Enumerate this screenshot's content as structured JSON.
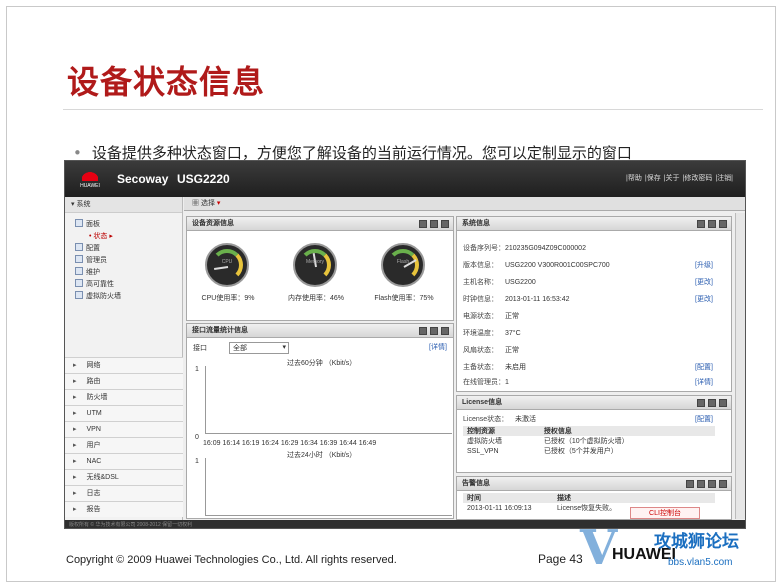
{
  "slide": {
    "title": "设备状态信息",
    "bullet": "设备提供多种状态窗口，方便您了解设备的当前运行情况。您可以定制显示的窗口",
    "copyright": "Copyright © 2009 Huawei Technologies Co., Ltd. All rights reserved.",
    "page": "Page 43",
    "footer_logo": "HUAWEI",
    "watermark_main": "攻城狮论坛",
    "watermark_sub": "bbs.vlan5.com",
    "watermark_letter": "V"
  },
  "app": {
    "logo_text": "HUAWEI",
    "brand": "Secoway",
    "model": "USG2220",
    "top_links": [
      "|帮助",
      "|保存",
      "|关于",
      "|修改密码",
      "|注销|"
    ],
    "toolbar_label": "选择",
    "sidebar_head": "系统",
    "tree": [
      "面板",
      "状态",
      "配置",
      "管理员",
      "维护",
      "高可靠性",
      "虚拟防火墙"
    ],
    "nav": [
      "网络",
      "路由",
      "防火墙",
      "UTM",
      "VPN",
      "用户",
      "NAC",
      "无线&DSL",
      "日志",
      "报告"
    ],
    "status_text": "版权所有 © 华为技术有限公司 2008-2012 保留一切权利",
    "cli_button": "CLI控制台"
  },
  "resource_panel": {
    "title": "设备资源信息",
    "gauges": [
      {
        "name": "CPU",
        "value": "9",
        "caption": "CPU使用率：9%",
        "percent": 9
      },
      {
        "name": "Memory",
        "value": "46",
        "caption": "内存使用率：46%",
        "percent": 46
      },
      {
        "name": "Flash",
        "value": "75",
        "caption": "Flash使用率：75%",
        "percent": 75
      }
    ]
  },
  "traffic_panel": {
    "title": "接口流量统计信息",
    "iface_label": "接口",
    "iface_value": "全部",
    "detail_link": "[详情]",
    "chart1_title": "过去60分钟 （Kbit/s）",
    "chart2_title": "过去24小时 （Kbit/s）",
    "y_top": "1",
    "y_bottom": "0",
    "y2_top": "1",
    "x_ticks": "16:09 16:14 16:19 16:24 16:29 16:34 16:39 16:44 16:49"
  },
  "system_panel": {
    "title": "系统信息",
    "rows": [
      {
        "label": "设备序列号：",
        "value": "210235G094Z09C000002",
        "link": ""
      },
      {
        "label": "版本信息：",
        "value": "USG2200 V300R001C00SPC700",
        "link": "[升级]"
      },
      {
        "label": "主机名称：",
        "value": "USG2200",
        "link": "[更改]"
      },
      {
        "label": "时钟信息：",
        "value": "2013-01-11 16:53:42",
        "link": "[更改]"
      },
      {
        "label": "电源状态：",
        "value": "正常",
        "link": ""
      },
      {
        "label": "环境温度：",
        "value": "37°C",
        "link": ""
      },
      {
        "label": "风扇状态：",
        "value": "正常",
        "link": ""
      },
      {
        "label": "主备状态：",
        "value": "未启用",
        "link": "[配置]"
      },
      {
        "label": "在线管理员：",
        "value": "1",
        "link": "[详情]"
      }
    ]
  },
  "license_panel": {
    "title": "License信息",
    "status_label": "License状态：",
    "status_value": "未激活",
    "status_link": "[配置]",
    "headers": [
      "控制资源",
      "授权信息"
    ],
    "rows": [
      [
        "虚拟防火墙",
        "已授权（10个虚拟防火墙）"
      ],
      [
        "SSL_VPN",
        "已授权（5个并发用户）"
      ]
    ]
  },
  "alarm_panel": {
    "title": "告警信息",
    "headers": [
      "时间",
      "描述"
    ],
    "rows": [
      [
        "2013-01-11 16:09:13",
        "License恢复失败。"
      ]
    ]
  }
}
